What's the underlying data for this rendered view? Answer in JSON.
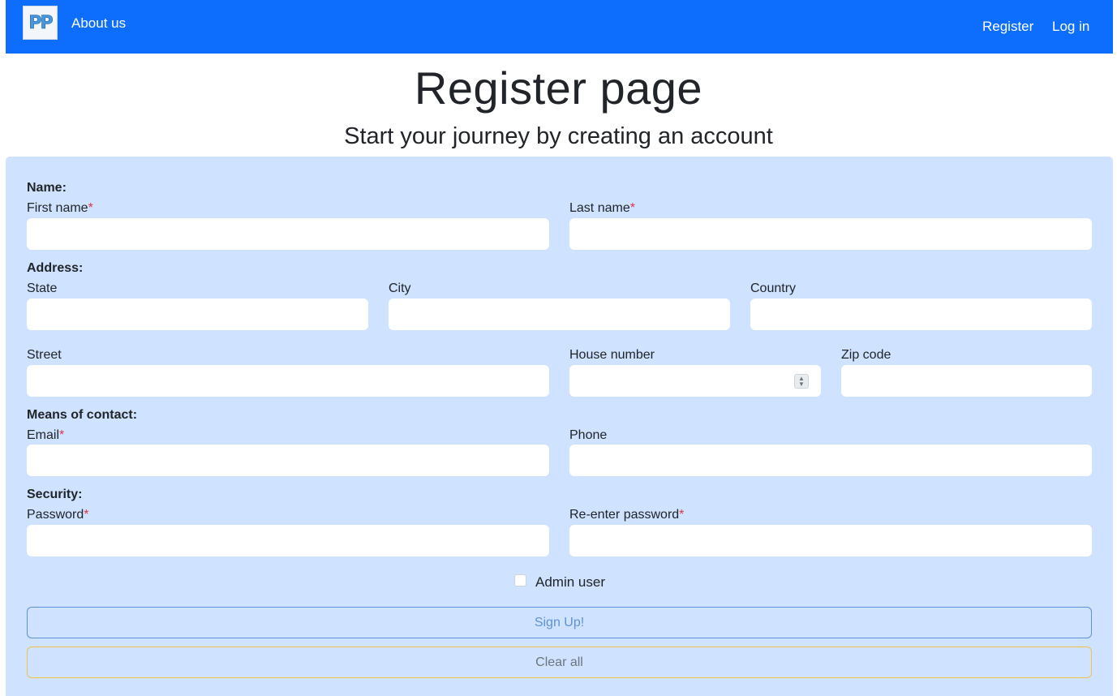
{
  "navbar": {
    "logo_text": "PP",
    "about_label": "About us",
    "register_label": "Register",
    "login_label": "Log in",
    "background": "#0d6efd"
  },
  "header": {
    "title": "Register page",
    "subtitle": "Start your journey by creating an account"
  },
  "form": {
    "name_section": "Name:",
    "first_name_label": "First name",
    "last_name_label": "Last name",
    "address_section": "Address:",
    "state_label": "State",
    "city_label": "City",
    "country_label": "Country",
    "street_label": "Street",
    "house_number_label": "House number",
    "zip_label": "Zip code",
    "contact_section": "Means of contact:",
    "email_label": "Email",
    "phone_label": "Phone",
    "security_section": "Security:",
    "password_label": "Password",
    "reenter_password_label": "Re-enter password",
    "required_marker": "*",
    "admin_label": "Admin user",
    "signup_label": "Sign Up!",
    "clear_label": "Clear all",
    "values": {
      "first_name": "",
      "last_name": "",
      "state": "",
      "city": "",
      "country": "",
      "street": "",
      "house_number": "",
      "zip": "",
      "email": "",
      "phone": "",
      "password": "",
      "reenter_password": ""
    },
    "card_color": "#cfe2ff"
  }
}
